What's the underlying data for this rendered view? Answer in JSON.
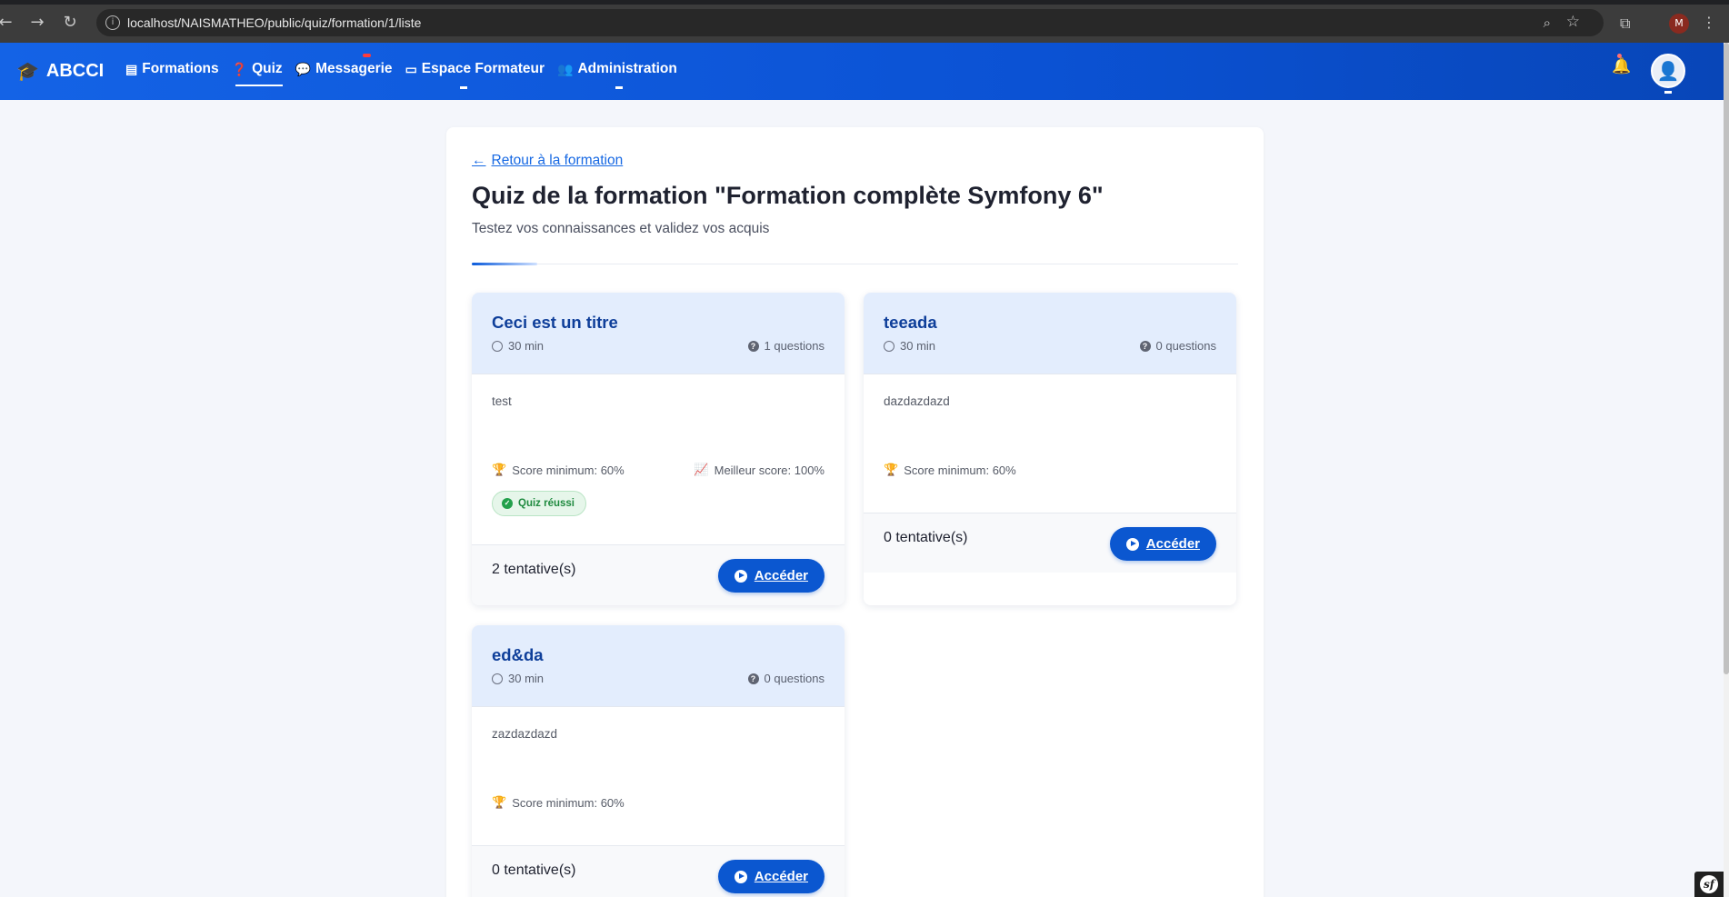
{
  "browser": {
    "url": "localhost/NAISMATHEO/public/quiz/formation/1/liste",
    "profile_initial": "M"
  },
  "navbar": {
    "brand": "ABCCI",
    "links": [
      {
        "label": "Formations",
        "icon": "book-icon"
      },
      {
        "label": "Quiz",
        "icon": "question-circle-icon"
      },
      {
        "label": "Messagerie",
        "icon": "comments-icon"
      },
      {
        "label": "Espace Formateur",
        "icon": "chalkboard-teacher-icon"
      },
      {
        "label": "Administration",
        "icon": "users-cog-icon"
      }
    ],
    "active": "Quiz"
  },
  "page": {
    "back_link": "Retour à la formation",
    "title": "Quiz de la formation \"Formation complète Symfony 6\"",
    "subtitle": "Testez vos connaissances et validez vos acquis"
  },
  "quizzes": [
    {
      "title": "Ceci est un titre",
      "duration": "30 min",
      "questions": "1 questions",
      "description": "test",
      "min_score": "Score minimum: 60%",
      "best_score": "Meilleur score: 100%",
      "badge": "Quiz réussi",
      "attempts": "2 tentative(s)",
      "button": "Accéder"
    },
    {
      "title": "teeada",
      "duration": "30 min",
      "questions": "0 questions",
      "description": "dazdazdazd",
      "min_score": "Score minimum: 60%",
      "attempts": "0 tentative(s)",
      "button": "Accéder"
    },
    {
      "title": "ed&da",
      "duration": "30 min",
      "questions": "0 questions",
      "description": "zazdazdazd",
      "min_score": "Score minimum: 60%",
      "attempts": "0 tentative(s)",
      "button": "Accéder"
    }
  ],
  "colors": {
    "primary": "#0b57d0",
    "card_header": "#e3edfd",
    "success": "#22a04b"
  }
}
